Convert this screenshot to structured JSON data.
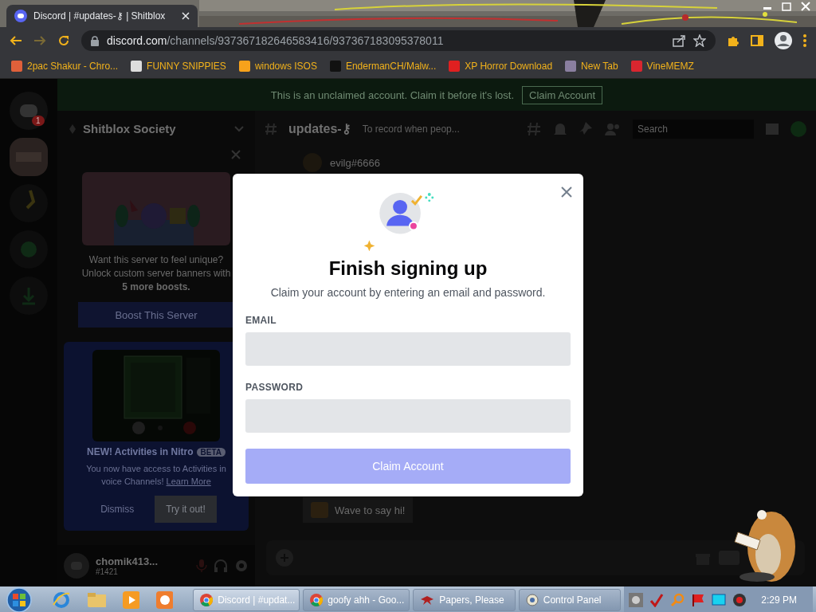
{
  "browser": {
    "tab": {
      "title": "Discord | #updates-⚷ | Shitblox"
    },
    "url": {
      "domain": "discord.com",
      "path": "/channels/937367182646583416/937367183095378011"
    },
    "bookmarks": [
      {
        "label": "2pac Shakur - Chro...",
        "color": "#e0603a"
      },
      {
        "label": "FUNNY SNIPPIES",
        "color": "#dddddd"
      },
      {
        "label": "windows ISOS",
        "color": "#f7a21b"
      },
      {
        "label": "EndermanCH/Malw...",
        "color": "#111111"
      },
      {
        "label": "XP Horror Download",
        "color": "#e02020"
      },
      {
        "label": "New Tab",
        "color": "#8a7fa0"
      },
      {
        "label": "VineMEMZ",
        "color": "#d8262f"
      }
    ]
  },
  "notice": {
    "text": "This is an unclaimed account. Claim it before it's lost.",
    "button": "Claim Account"
  },
  "rail": {
    "badge": "1"
  },
  "server": {
    "name": "Shitblox Society"
  },
  "boost_card": {
    "text": "Want this server to feel unique? Unlock custom server banners with **5 more boosts.**",
    "button": "Boost This Server"
  },
  "nitro_card": {
    "title": "NEW! Activities in Nitro",
    "badge": "BETA",
    "text": "You now have access to Activities in voice Channels!",
    "link": "Learn More",
    "dismiss": "Dismiss",
    "try": "Try it out!"
  },
  "user": {
    "name": "chomik413...",
    "tag": "#1421"
  },
  "channel": {
    "name": "updates-⚷",
    "topic": "To record when peop...",
    "search_placeholder": "Search"
  },
  "messages": [
    {
      "author": "evilg#6666"
    }
  ],
  "wave": "Wave to say hi!",
  "modal": {
    "title": "Finish signing up",
    "subtitle": "Claim your account by entering an email and password.",
    "fields": [
      {
        "label": "EMAIL"
      },
      {
        "label": "PASSWORD"
      }
    ],
    "button": "Claim Account"
  },
  "taskbar": {
    "windows": [
      {
        "label": "Discord | #updat...",
        "selected": true,
        "kind": "chrome"
      },
      {
        "label": "goofy ahh - Goo...",
        "selected": false,
        "kind": "chrome"
      },
      {
        "label": "Papers, Please",
        "selected": false,
        "kind": "game"
      },
      {
        "label": "Control Panel",
        "selected": false,
        "kind": "panel"
      }
    ],
    "clock": "2:29 PM"
  }
}
